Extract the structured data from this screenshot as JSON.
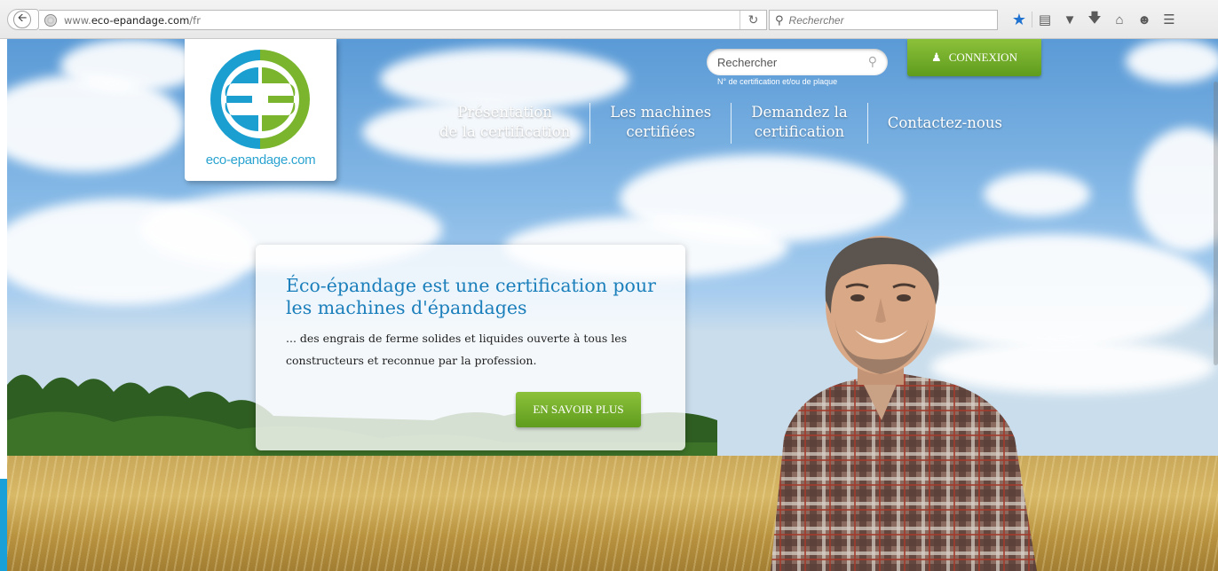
{
  "browser": {
    "url_prefix": "www.",
    "url_host": "eco-epandage.com",
    "url_path": "/fr",
    "search_placeholder": "Rechercher"
  },
  "site": {
    "logo_text": "eco-epandage.com",
    "search": {
      "placeholder": "Rechercher",
      "hint": "N° de certification et/ou de plaque"
    },
    "login_label": "CONNEXION",
    "nav": [
      {
        "line1": "Présentation",
        "line2": "de la certification"
      },
      {
        "line1": "Les machines",
        "line2": "certifiées"
      },
      {
        "line1": "Demandez la",
        "line2": "certification"
      },
      {
        "line1": "Contactez-nous",
        "line2": ""
      }
    ],
    "hero": {
      "title": "Éco-épandage est une certification pour les machines d'épandages",
      "text": "... des engrais de ferme solides et liquides ouverte à tous les constructeurs et reconnue par la profession.",
      "button": "EN SAVOIR PLUS"
    }
  },
  "colors": {
    "accent_green": "#7ab52d",
    "brand_blue": "#1b9fd1",
    "title_blue": "#1b7fbb"
  },
  "icons": [
    "back-arrow-icon",
    "globe-icon",
    "reload-icon",
    "search-icon",
    "star-icon",
    "reading-list-icon",
    "pocket-icon",
    "download-icon",
    "home-icon",
    "chat-icon",
    "menu-icon",
    "user-icon"
  ]
}
